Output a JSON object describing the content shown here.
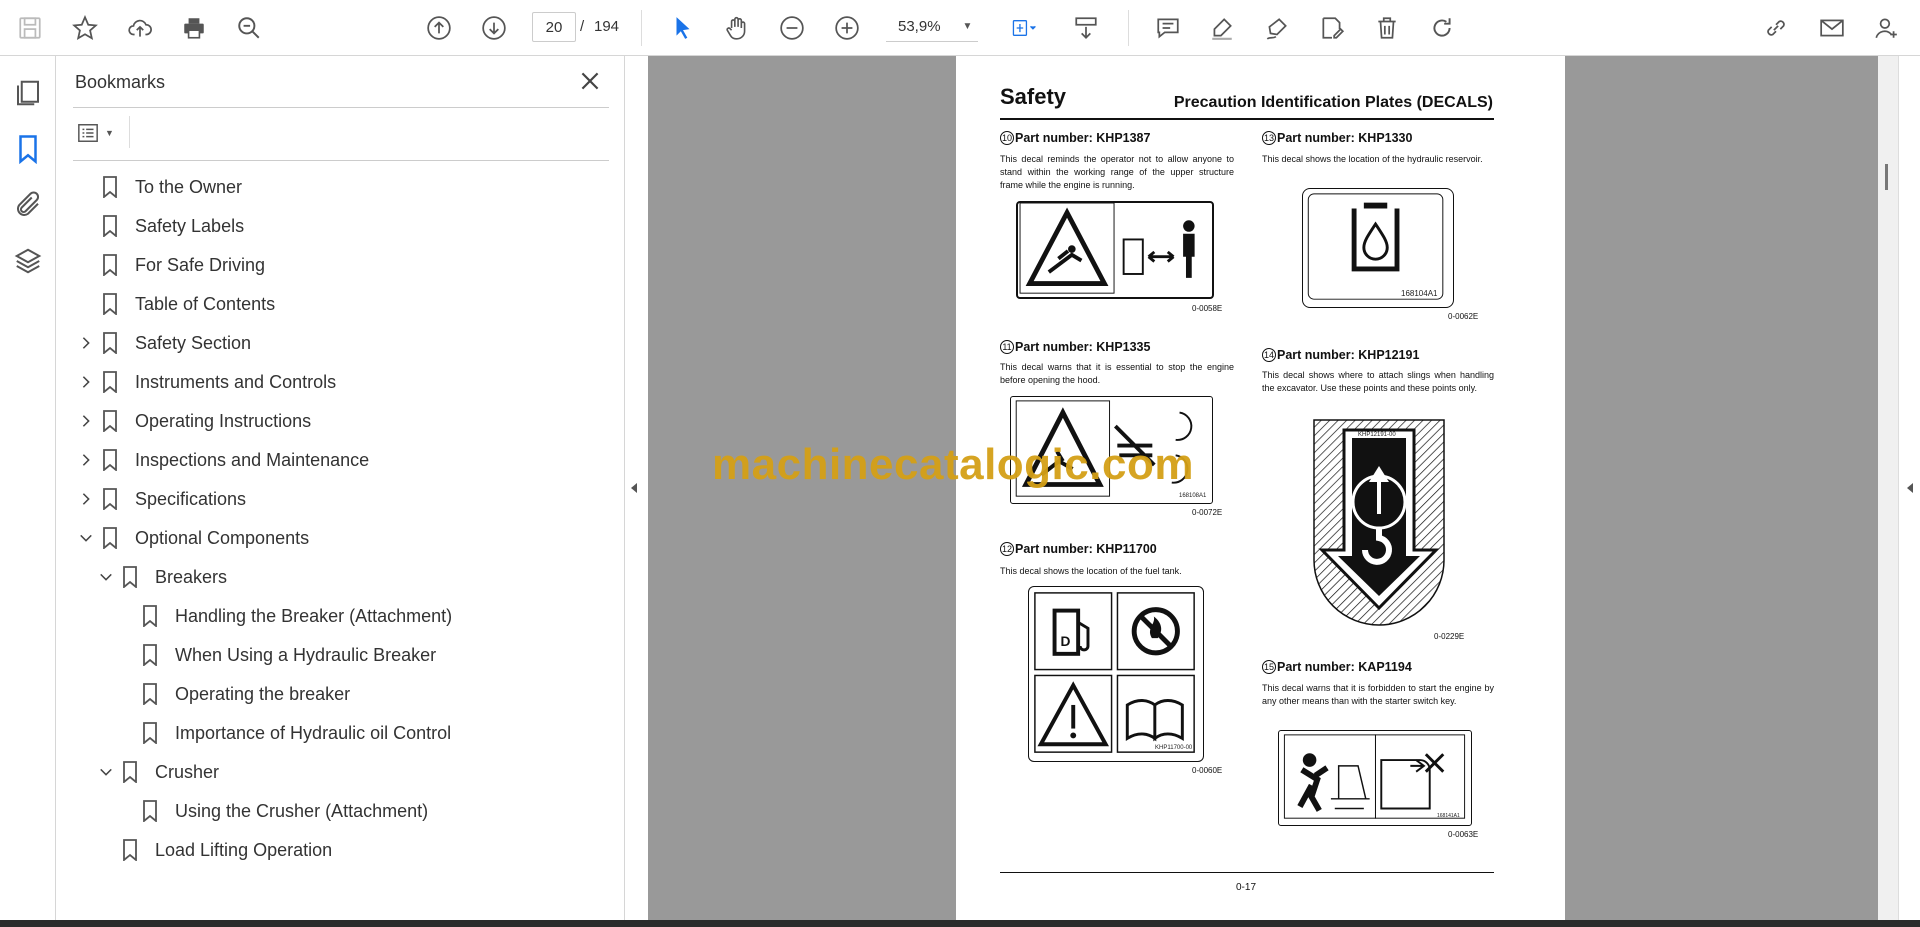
{
  "toolbar": {
    "page_current": "20",
    "page_separator": "/",
    "page_total": "194",
    "zoom": "53,9%",
    "icons": [
      "save-icon",
      "star-icon",
      "upload-icon",
      "print-icon",
      "zoom-search-icon",
      "prev-page-icon",
      "next-page-icon",
      "select-arrow-icon",
      "hand-icon",
      "zoom-out-icon",
      "zoom-in-icon",
      "fit-page-icon",
      "scroll-mode-icon",
      "comment-icon",
      "highlight-icon",
      "sign-icon",
      "edit-pdf-icon",
      "delete-icon",
      "rotate-icon",
      "link-icon",
      "mail-icon",
      "account-icon"
    ]
  },
  "sidebar": {
    "title": "Bookmarks",
    "items": [
      {
        "label": "To the Owner",
        "level": 0,
        "toggle": "none"
      },
      {
        "label": "Safety Labels",
        "level": 0,
        "toggle": "none"
      },
      {
        "label": "For Safe Driving",
        "level": 0,
        "toggle": "none"
      },
      {
        "label": "Table of Contents",
        "level": 0,
        "toggle": "none"
      },
      {
        "label": "Safety Section",
        "level": 0,
        "toggle": "collapsed"
      },
      {
        "label": "Instruments and Controls",
        "level": 0,
        "toggle": "collapsed"
      },
      {
        "label": "Operating Instructions",
        "level": 0,
        "toggle": "collapsed"
      },
      {
        "label": "Inspections and Maintenance",
        "level": 0,
        "toggle": "collapsed"
      },
      {
        "label": "Specifications",
        "level": 0,
        "toggle": "collapsed"
      },
      {
        "label": "Optional Components",
        "level": 0,
        "toggle": "expanded"
      },
      {
        "label": "Breakers",
        "level": 1,
        "toggle": "expanded"
      },
      {
        "label": "Handling the Breaker (Attachment)",
        "level": 2,
        "toggle": "none"
      },
      {
        "label": "When Using a Hydraulic Breaker",
        "level": 2,
        "toggle": "none"
      },
      {
        "label": "Operating the breaker",
        "level": 2,
        "toggle": "none"
      },
      {
        "label": "Importance of Hydraulic oil Control",
        "level": 2,
        "toggle": "none"
      },
      {
        "label": "Crusher",
        "level": 1,
        "toggle": "expanded"
      },
      {
        "label": "Using the Crusher (Attachment)",
        "level": 2,
        "toggle": "none"
      },
      {
        "label": "Load Lifting Operation",
        "level": 1,
        "toggle": "none"
      }
    ]
  },
  "document": {
    "title": "Safety",
    "subtitle": "Precaution Identification Plates (DECALS)",
    "page_number": "0-17",
    "decals": [
      {
        "num": "10",
        "part": "Part number: KHP1387",
        "desc": "This decal reminds the operator not to allow anyone to stand within the working range of the upper structure frame while the engine is running.",
        "code": "0-0058E",
        "plate_text": ""
      },
      {
        "num": "11",
        "part": "Part number: KHP1335",
        "desc": "This decal warns that it is essential to stop the engine before opening the hood.",
        "code": "0-0072E",
        "plate_text": "168108A1"
      },
      {
        "num": "12",
        "part": "Part number: KHP11700",
        "desc": "This decal shows the location of the fuel tank.",
        "code": "0-0060E",
        "plate_text": "KHP11700-00"
      },
      {
        "num": "13",
        "part": "Part number: KHP1330",
        "desc": "This decal shows the location of the hydraulic reservoir.",
        "code": "0-0062E",
        "plate_text": "168104A1"
      },
      {
        "num": "14",
        "part": "Part number: KHP12191",
        "desc": "This decal shows where to attach slings when handling the excavator. Use these points and these points only.",
        "code": "0-0229E",
        "plate_text": "KHP12191-00"
      },
      {
        "num": "15",
        "part": "Part number: KAP1194",
        "desc": "This decal warns that it is forbidden to start the engine by any other means than with the starter switch key.",
        "code": "0-0063E",
        "plate_text": "168141A1"
      }
    ]
  },
  "watermark": "machinecatalogic.com"
}
